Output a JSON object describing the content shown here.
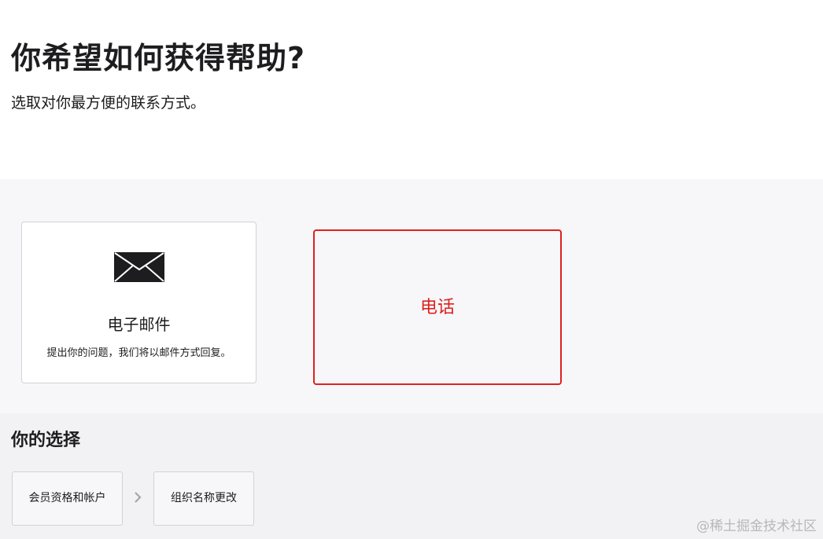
{
  "header": {
    "title": "你希望如何获得帮助?",
    "subtitle": "选取对你最方便的联系方式。"
  },
  "options": {
    "email": {
      "icon": "envelope-icon",
      "title": "电子邮件",
      "description": "提出你的问题，我们将以邮件方式回复。"
    },
    "phone": {
      "label": "电话",
      "highlight_color": "#e02020"
    }
  },
  "choices": {
    "title": "你的选择",
    "items": [
      {
        "label": "会员资格和帐户"
      },
      {
        "label": "组织名称更改"
      }
    ],
    "separator_icon": "chevron-right-icon"
  },
  "watermark": "@稀土掘金技术社区"
}
